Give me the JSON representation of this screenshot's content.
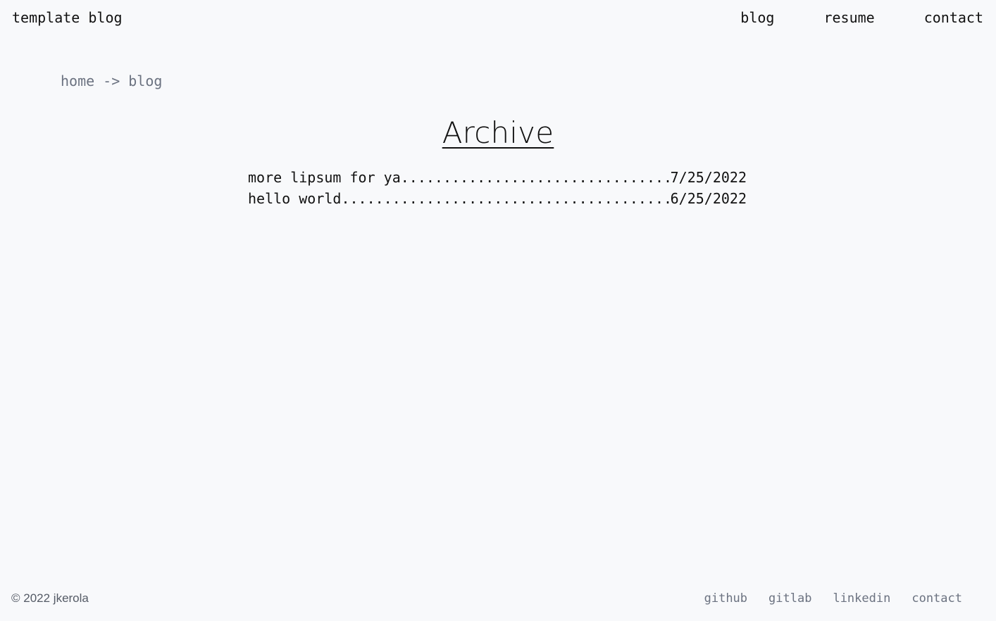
{
  "header": {
    "site_title": "template blog",
    "nav": [
      "blog",
      "resume",
      "contact"
    ]
  },
  "breadcrumb": {
    "home": "home",
    "separator": "->",
    "current": "blog"
  },
  "page_title": "Archive",
  "posts": [
    {
      "title": "more lipsum for ya",
      "date": "7/25/2022"
    },
    {
      "title": "hello world",
      "date": "6/25/2022"
    }
  ],
  "footer": {
    "copyright": "© 2022 jkerola",
    "links": [
      "github",
      "gitlab",
      "linkedin",
      "contact"
    ]
  }
}
